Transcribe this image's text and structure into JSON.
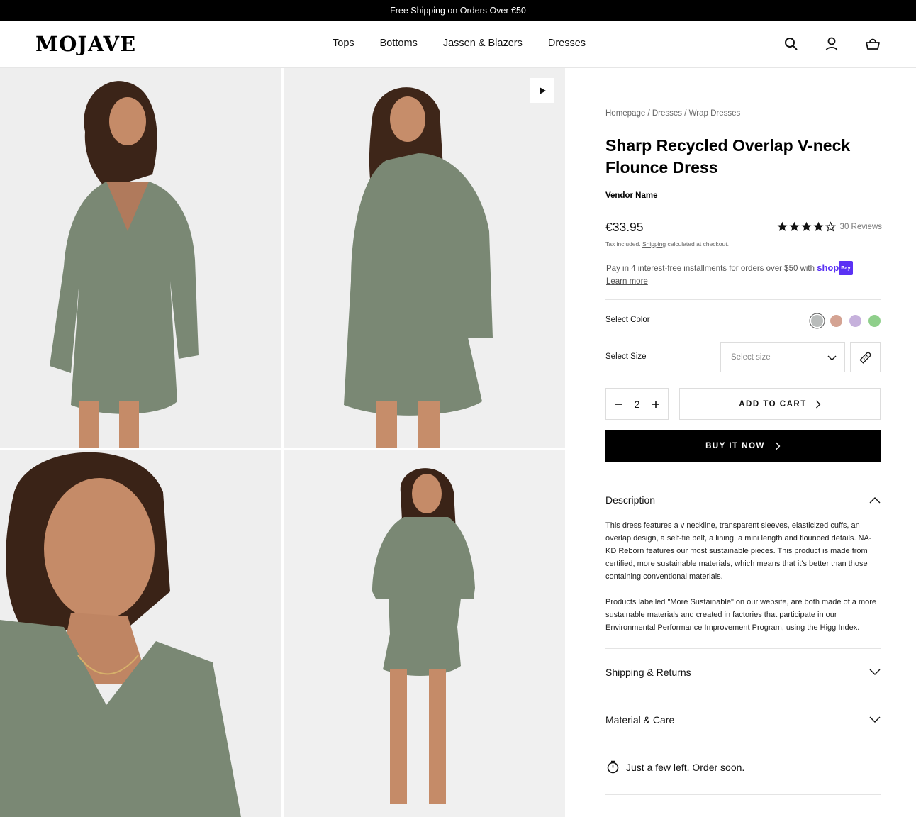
{
  "announcement": "Free Shipping on Orders Over €50",
  "brand": "MOJAVE",
  "nav": [
    "Tops",
    "Bottoms",
    "Jassen & Blazers",
    "Dresses"
  ],
  "header_icons": [
    "search-icon",
    "account-icon",
    "cart-icon"
  ],
  "gallery": {
    "images": [
      "model-front-view",
      "model-back-view",
      "model-closeup-smiling",
      "model-full-length"
    ],
    "video_icon": "play-icon"
  },
  "product": {
    "breadcrumb": [
      "Homepage",
      "Dresses",
      "Wrap Dresses"
    ],
    "title": "Sharp Recycled Overlap V-neck Flounce Dress",
    "vendor": "Vendor Name",
    "price": "€33.95",
    "rating": 4,
    "rating_max": 5,
    "reviews": "30 Reviews",
    "tax_prefix": "Tax included.",
    "tax_link": "Shipping",
    "tax_suffix": "calculated at checkout.",
    "installments_text": "Pay in 4 interest-free installments for orders over $50 with",
    "shop_brand": "shop",
    "shop_badge": "Pay",
    "learn_more": "Learn more"
  },
  "options": {
    "color_label": "Select Color",
    "colors": [
      "#b9bcbb",
      "#d4a393",
      "#c6b1dc",
      "#8fcf8b"
    ],
    "selected_color_index": 0,
    "size_label": "Select Size",
    "size_placeholder": "Select size",
    "size_guide_icon": "ruler-icon"
  },
  "cart": {
    "quantity": "2",
    "add_to_cart": "ADD TO CART",
    "buy_now": "BUY IT NOW"
  },
  "accordions": {
    "description_title": "Description",
    "description_p1": "This dress features a v neckline, transparent sleeves, elasticized cuffs, an overlap design, a self-tie belt, a lining, a mini length and flounced details. NA-KD Reborn features our most sustainable pieces. This product is made from certified, more sustainable materials, which means that it's better than those containing conventional materials.",
    "description_p2": "Products labelled \"More Sustainable\" on our website, are both made of a more sustainable materials and created in factories that participate in our Environmental Performance Improvement Program, using the Higg Index.",
    "shipping_title": "Shipping & Returns",
    "material_title": "Material & Care"
  },
  "stock_message": "Just a few left. Order soon.",
  "colors": {
    "accent": "#000000",
    "shop_pay": "#5a31f4",
    "dress": "#7a8874",
    "photo_bg": "#eeeeee"
  }
}
